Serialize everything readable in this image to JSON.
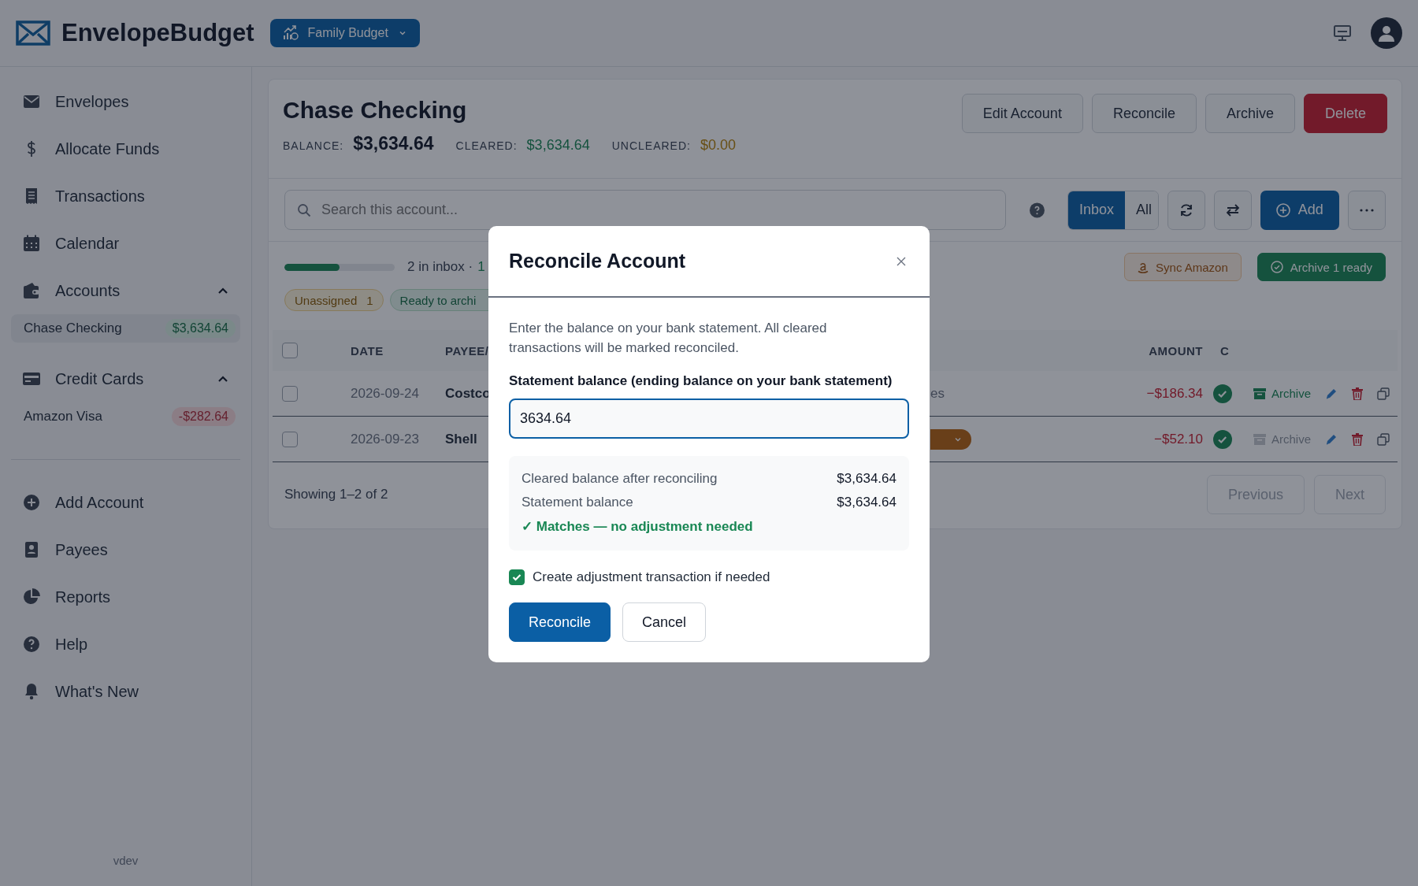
{
  "app": {
    "name": "EnvelopeBudget"
  },
  "budget_selector": {
    "label": "Family Budget"
  },
  "sidebar": {
    "items": [
      {
        "kind": "link",
        "label": "Envelopes"
      },
      {
        "kind": "link",
        "label": "Allocate Funds"
      },
      {
        "kind": "link",
        "label": "Transactions"
      },
      {
        "kind": "link",
        "label": "Calendar"
      },
      {
        "kind": "group",
        "label": "Accounts",
        "expanded": true,
        "children": [
          {
            "label": "Chase Checking",
            "balance": "$3,634.64",
            "kind": "positive",
            "selected": true
          }
        ]
      },
      {
        "kind": "group",
        "label": "Credit Cards",
        "expanded": true,
        "children": [
          {
            "label": "Amazon Visa",
            "balance": "-$282.64",
            "kind": "negative",
            "selected": false
          }
        ]
      },
      {
        "kind": "divider"
      },
      {
        "kind": "link",
        "label": "Add Account"
      },
      {
        "kind": "link",
        "label": "Payees"
      },
      {
        "kind": "link",
        "label": "Reports"
      },
      {
        "kind": "link",
        "label": "Help"
      },
      {
        "kind": "link",
        "label": "What's New"
      }
    ],
    "version": "vdev"
  },
  "account": {
    "title": "Chase Checking",
    "buttons": [
      {
        "label": "Edit Account",
        "kind": "default"
      },
      {
        "label": "Reconcile",
        "kind": "default"
      },
      {
        "label": "Archive",
        "kind": "default"
      },
      {
        "label": "Delete",
        "kind": "danger"
      }
    ],
    "balances": [
      {
        "label": "BALANCE:",
        "value": "$3,634.64",
        "kind": "total"
      },
      {
        "label": "CLEARED:",
        "value": "$3,634.64",
        "kind": "cleared"
      },
      {
        "label": "UNCLEARED:",
        "value": "$0.00",
        "kind": "uncleared"
      }
    ]
  },
  "toolbar": {
    "search": {
      "placeholder": "Search this account..."
    },
    "views": [
      {
        "label": "Inbox",
        "selected": true
      },
      {
        "label": "All",
        "selected": false
      }
    ],
    "add_button": "Add"
  },
  "inbox": {
    "level": 0.5,
    "text": "2 in inbox ·",
    "count": "1",
    "actions": [
      {
        "label": "Sync Amazon",
        "kind": "amazon"
      },
      {
        "label": "Archive 1 ready",
        "kind": "archive"
      }
    ],
    "chips": [
      {
        "label": "Unassigned",
        "count": "1",
        "kind": "warning"
      },
      {
        "label": "Ready to archi",
        "kind": "success"
      }
    ]
  },
  "table": {
    "select_all": {
      "checked": false
    },
    "columns": [
      "DATE",
      "PAYEE/",
      "AMOUNT",
      "C"
    ],
    "rows": [
      {
        "checked": false,
        "date": "2026-09-24",
        "payee": "Costco",
        "memo": {
          "kind": "text",
          "text": "es"
        },
        "amount": "−$186.34",
        "cleared": true,
        "archive": {
          "label": "Archive",
          "disabled": false
        }
      },
      {
        "checked": false,
        "date": "2026-09-23",
        "payee": "Shell",
        "memo": {
          "kind": "dropdown"
        },
        "amount": "−$52.10",
        "cleared": true,
        "archive": {
          "label": "Archive",
          "disabled": true
        }
      }
    ]
  },
  "pagination": {
    "summary": "Showing 1–2 of 2",
    "buttons": [
      {
        "label": "Previous",
        "disabled": true
      },
      {
        "label": "Next",
        "disabled": true
      }
    ]
  },
  "modal": {
    "title": "Reconcile Account",
    "description": "Enter the balance on your bank statement. All cleared transactions will be marked reconciled.",
    "field": {
      "label": "Statement balance (ending balance on your bank statement)",
      "value": "3634.64"
    },
    "summary": [
      {
        "label": "Cleared balance after reconciling",
        "value": "$3,634.64"
      },
      {
        "label": "Statement balance",
        "value": "$3,634.64"
      }
    ],
    "match": {
      "text": "✓ Matches — no adjustment needed",
      "ok": true
    },
    "checkbox": {
      "label": "Create adjustment transaction if needed",
      "checked": true
    },
    "buttons": [
      {
        "label": "Reconcile",
        "kind": "primary"
      },
      {
        "label": "Cancel",
        "kind": "default"
      }
    ]
  }
}
